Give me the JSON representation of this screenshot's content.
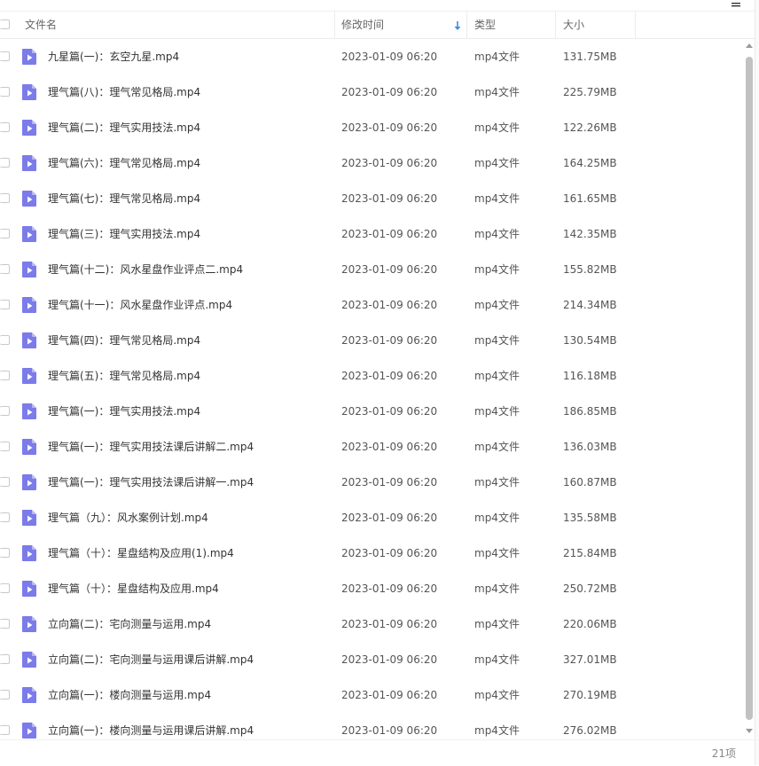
{
  "columns": {
    "name": "文件名",
    "modified": "修改时间",
    "type": "类型",
    "size": "大小"
  },
  "sort_icon": "arrow-down-icon",
  "file_icon": "video-file-icon",
  "accent_color": "#3a8ee6",
  "file_icon_color": "#7b7bea",
  "files": [
    {
      "name": "九星篇(一)：玄空九星.mp4",
      "modified": "2023-01-09 06:20",
      "type": "mp4文件",
      "size": "131.75MB"
    },
    {
      "name": "理气篇(八)：理气常见格局.mp4",
      "modified": "2023-01-09 06:20",
      "type": "mp4文件",
      "size": "225.79MB"
    },
    {
      "name": "理气篇(二)：理气实用技法.mp4",
      "modified": "2023-01-09 06:20",
      "type": "mp4文件",
      "size": "122.26MB"
    },
    {
      "name": "理气篇(六)：理气常见格局.mp4",
      "modified": "2023-01-09 06:20",
      "type": "mp4文件",
      "size": "164.25MB"
    },
    {
      "name": "理气篇(七)：理气常见格局.mp4",
      "modified": "2023-01-09 06:20",
      "type": "mp4文件",
      "size": "161.65MB"
    },
    {
      "name": "理气篇(三)：理气实用技法.mp4",
      "modified": "2023-01-09 06:20",
      "type": "mp4文件",
      "size": "142.35MB"
    },
    {
      "name": "理气篇(十二)：风水星盘作业评点二.mp4",
      "modified": "2023-01-09 06:20",
      "type": "mp4文件",
      "size": "155.82MB"
    },
    {
      "name": "理气篇(十一)：风水星盘作业评点.mp4",
      "modified": "2023-01-09 06:20",
      "type": "mp4文件",
      "size": "214.34MB"
    },
    {
      "name": "理气篇(四)：理气常见格局.mp4",
      "modified": "2023-01-09 06:20",
      "type": "mp4文件",
      "size": "130.54MB"
    },
    {
      "name": "理气篇(五)：理气常见格局.mp4",
      "modified": "2023-01-09 06:20",
      "type": "mp4文件",
      "size": "116.18MB"
    },
    {
      "name": "理气篇(一)：理气实用技法.mp4",
      "modified": "2023-01-09 06:20",
      "type": "mp4文件",
      "size": "186.85MB"
    },
    {
      "name": "理气篇(一)：理气实用技法课后讲解二.mp4",
      "modified": "2023-01-09 06:20",
      "type": "mp4文件",
      "size": "136.03MB"
    },
    {
      "name": "理气篇(一)：理气实用技法课后讲解一.mp4",
      "modified": "2023-01-09 06:20",
      "type": "mp4文件",
      "size": "160.87MB"
    },
    {
      "name": "理气篇（九）：风水案例计划.mp4",
      "modified": "2023-01-09 06:20",
      "type": "mp4文件",
      "size": "135.58MB"
    },
    {
      "name": "理气篇（十）：星盘结构及应用(1).mp4",
      "modified": "2023-01-09 06:20",
      "type": "mp4文件",
      "size": "215.84MB"
    },
    {
      "name": "理气篇（十）：星盘结构及应用.mp4",
      "modified": "2023-01-09 06:20",
      "type": "mp4文件",
      "size": "250.72MB"
    },
    {
      "name": "立向篇(二)：宅向测量与运用.mp4",
      "modified": "2023-01-09 06:20",
      "type": "mp4文件",
      "size": "220.06MB"
    },
    {
      "name": "立向篇(二)：宅向测量与运用课后讲解.mp4",
      "modified": "2023-01-09 06:20",
      "type": "mp4文件",
      "size": "327.01MB"
    },
    {
      "name": "立向篇(一)：楼向测量与运用.mp4",
      "modified": "2023-01-09 06:20",
      "type": "mp4文件",
      "size": "270.19MB"
    },
    {
      "name": "立向篇(一)：楼向测量与运用课后讲解.mp4",
      "modified": "2023-01-09 06:20",
      "type": "mp4文件",
      "size": "276.02MB"
    }
  ],
  "footer": {
    "count": "21项"
  }
}
